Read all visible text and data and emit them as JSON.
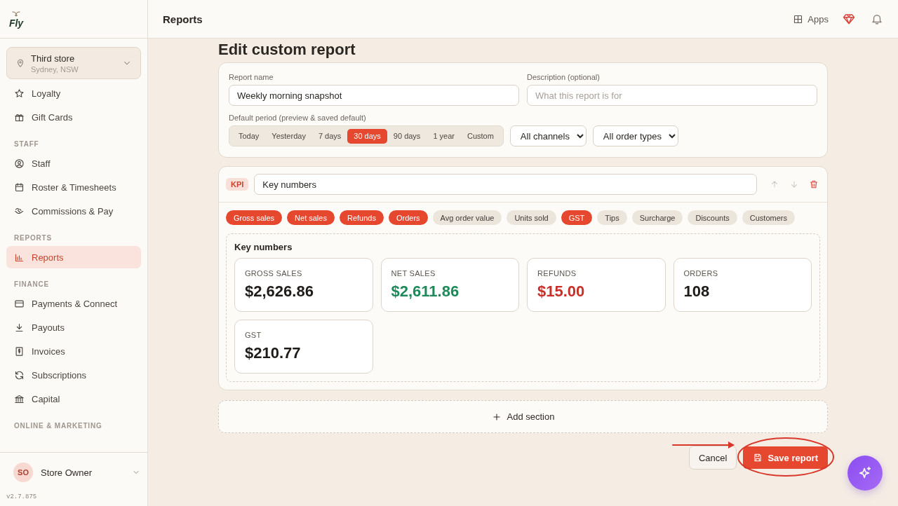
{
  "sidebar": {
    "logo_text": "Fly",
    "store": {
      "name": "Third store",
      "location": "Sydney, NSW"
    },
    "sections": [
      {
        "items": [
          {
            "label": "Loyalty",
            "selected": false
          },
          {
            "label": "Gift Cards",
            "selected": false
          }
        ]
      },
      {
        "heading": "STAFF",
        "items": [
          {
            "label": "Staff",
            "selected": false
          },
          {
            "label": "Roster & Timesheets",
            "selected": false
          },
          {
            "label": "Commissions & Pay",
            "selected": false
          }
        ]
      },
      {
        "heading": "REPORTS",
        "items": [
          {
            "label": "Reports",
            "selected": true
          }
        ]
      },
      {
        "heading": "FINANCE",
        "items": [
          {
            "label": "Payments & Connect",
            "selected": false
          },
          {
            "label": "Payouts",
            "selected": false
          },
          {
            "label": "Invoices",
            "selected": false
          },
          {
            "label": "Subscriptions",
            "selected": false
          },
          {
            "label": "Capital",
            "selected": false
          }
        ]
      },
      {
        "heading": "ONLINE & MARKETING"
      }
    ],
    "user": {
      "initials": "SO",
      "name": "Store Owner"
    },
    "version": "v2.7.875"
  },
  "header": {
    "title": "Reports",
    "apps": "Apps"
  },
  "page_title": "Edit custom report",
  "form": {
    "name": {
      "label": "Report name",
      "value": "Weekly morning snapshot"
    },
    "description": {
      "label": "Description (optional)",
      "placeholder": "What this report is for"
    },
    "period_label": "Default period (preview & saved default)",
    "periods": [
      {
        "label": "Today",
        "selected": false
      },
      {
        "label": "Yesterday",
        "selected": false
      },
      {
        "label": "7 days",
        "selected": false
      },
      {
        "label": "30 days",
        "selected": true
      },
      {
        "label": "90 days",
        "selected": false
      },
      {
        "label": "1 year",
        "selected": false
      },
      {
        "label": "Custom",
        "selected": false
      }
    ],
    "channel": "All channels",
    "order_type": "All order types"
  },
  "section": {
    "badge": "KPI",
    "title": "Key numbers",
    "actions": [
      {
        "kind": "up",
        "disabled": true
      },
      {
        "kind": "down",
        "disabled": true
      },
      {
        "kind": "delete",
        "disabled": false
      }
    ],
    "metrics": [
      {
        "label": "Gross sales",
        "selected": true
      },
      {
        "label": "Net sales",
        "selected": true
      },
      {
        "label": "Refunds",
        "selected": true
      },
      {
        "label": "Orders",
        "selected": true
      },
      {
        "label": "Avg order value",
        "selected": false
      },
      {
        "label": "Units sold",
        "selected": false
      },
      {
        "label": "GST",
        "selected": true
      },
      {
        "label": "Tips",
        "selected": false
      },
      {
        "label": "Surcharge",
        "selected": false
      },
      {
        "label": "Discounts",
        "selected": false
      },
      {
        "label": "Customers",
        "selected": false
      }
    ],
    "preview_title": "Key numbers",
    "cards": [
      {
        "label": "GROSS SALES",
        "value": "$2,626.86",
        "color": "#1f1b18"
      },
      {
        "label": "NET SALES",
        "value": "$2,611.86",
        "color": "#1e8a5a"
      },
      {
        "label": "REFUNDS",
        "value": "$15.00",
        "color": "#c8302a"
      },
      {
        "label": "ORDERS",
        "value": "108",
        "color": "#1f1b18"
      },
      {
        "label": "GST",
        "value": "$210.77",
        "color": "#1f1b18"
      }
    ]
  },
  "add_section": "Add section",
  "buttons": {
    "cancel": "Cancel",
    "save": "Save report"
  }
}
